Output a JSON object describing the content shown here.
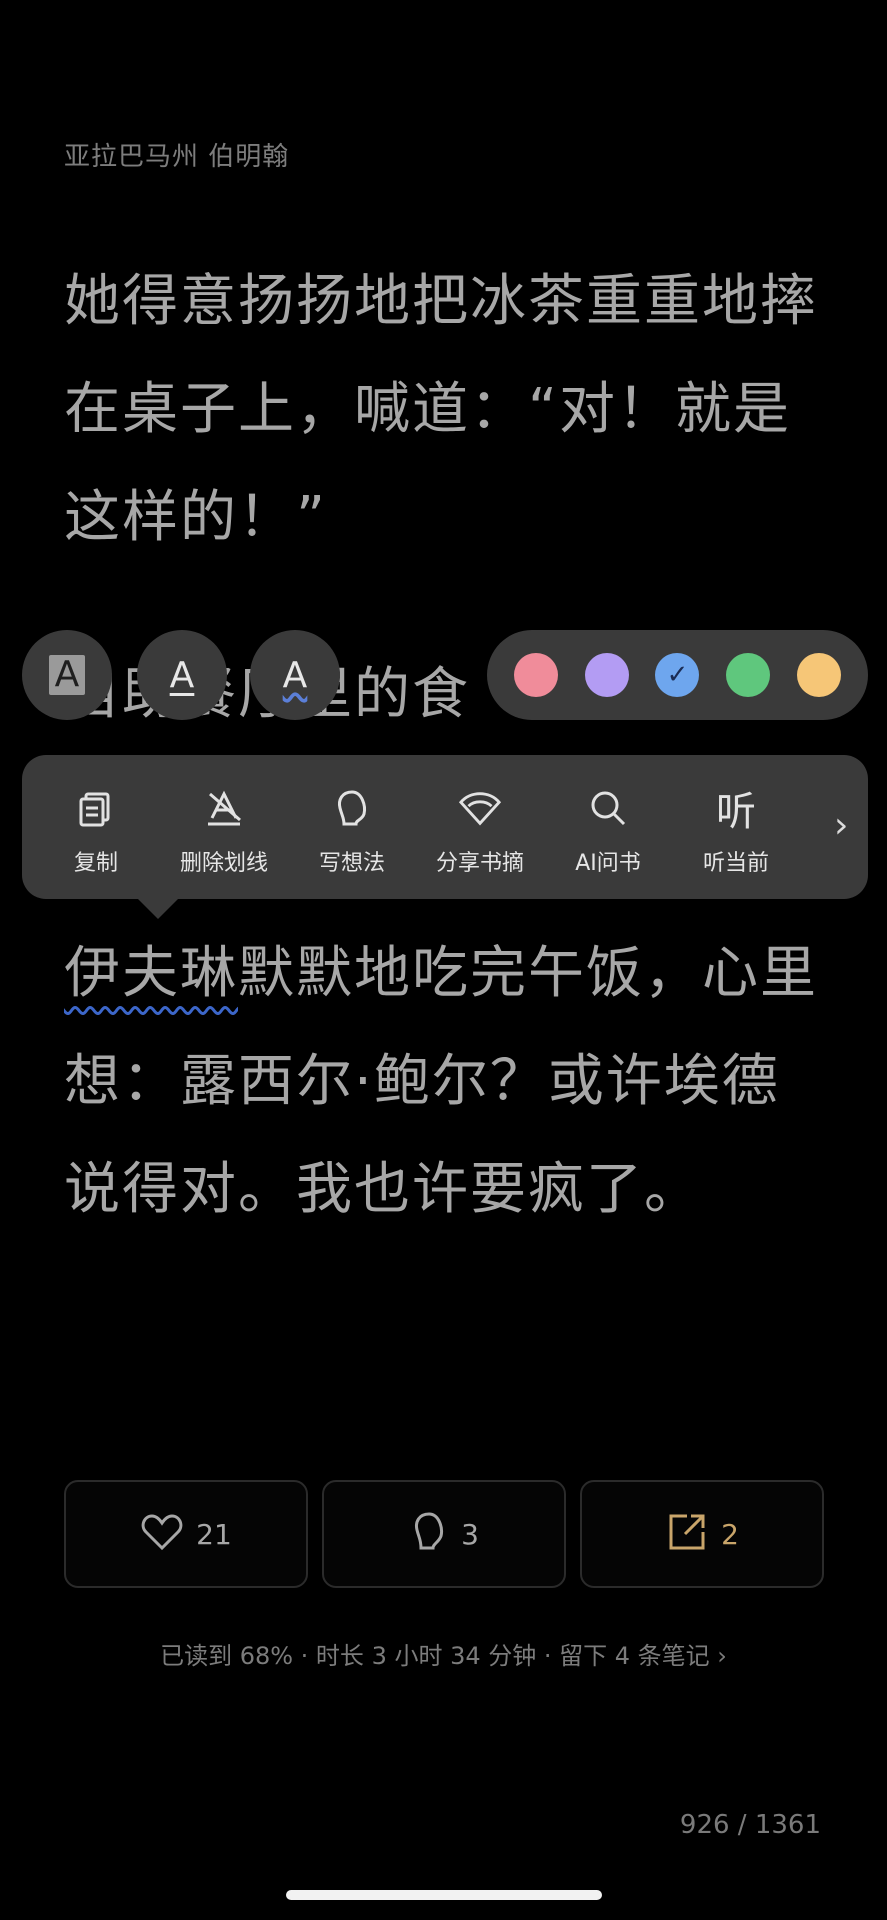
{
  "chapter_title": "亚拉巴马州 伯明翰",
  "paragraphs": {
    "p1": "她得意扬扬地把冰茶重重地摔在桌子上，喊道：“对！就是这样的！”",
    "p2": "自助餐厅里的食",
    "p3_highlight": "伊夫琳",
    "p3_rest": "默默地吃完午饭，心里想：露西尔·鲍尔？或许埃德说得对。我也许要疯了。"
  },
  "style_buttons": [
    {
      "glyph": "A",
      "name": "highlight-style"
    },
    {
      "glyph": "A",
      "name": "underline-style"
    },
    {
      "glyph": "A",
      "name": "wavy-underline-style"
    }
  ],
  "colors": [
    {
      "hex": "#f08c9a",
      "selected": false
    },
    {
      "hex": "#b39cf3",
      "selected": false
    },
    {
      "hex": "#6ea6ee",
      "selected": true,
      "check": "✓"
    },
    {
      "hex": "#5fc77d",
      "selected": false
    },
    {
      "hex": "#f6c677",
      "selected": false
    }
  ],
  "menu": {
    "items": [
      {
        "label": "复制",
        "icon": "copy-icon"
      },
      {
        "label": "删除划线",
        "icon": "delete-underline-icon"
      },
      {
        "label": "写想法",
        "icon": "thought-icon"
      },
      {
        "label": "分享书摘",
        "icon": "share-excerpt-icon"
      },
      {
        "label": "AI问书",
        "icon": "search-icon"
      },
      {
        "label": "听当前",
        "icon": "listen-icon",
        "glyph": "听"
      }
    ],
    "more": "›"
  },
  "actions": {
    "likes": "21",
    "comments": "3",
    "shares": "2"
  },
  "status_line": "已读到 68% · 时长 3 小时 34 分钟 · 留下 4 条笔记 ›",
  "page_number": "926 / 1361"
}
